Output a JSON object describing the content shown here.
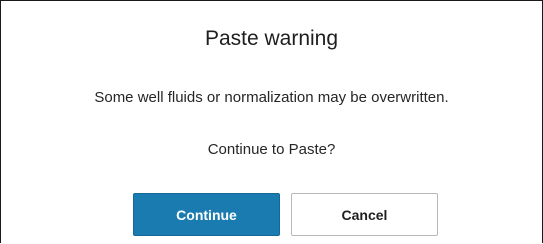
{
  "dialog": {
    "title": "Paste warning",
    "message": "Some well fluids or normalization may be overwritten.",
    "question": "Continue to Paste?",
    "buttons": {
      "continue_label": "Continue",
      "cancel_label": "Cancel"
    }
  },
  "colors": {
    "primary_button": "#1a7bb0",
    "secondary_button_border": "#b8b8b8",
    "dialog_border": "#1a1a1a"
  }
}
